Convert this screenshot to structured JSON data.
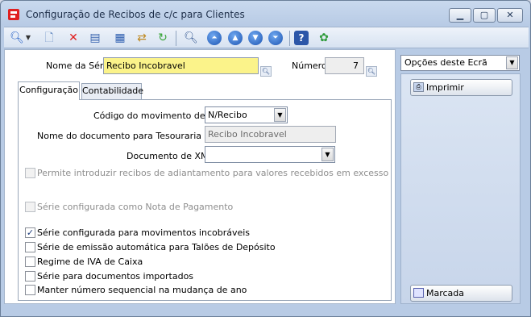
{
  "window": {
    "title": "Configuração de Recibos de c/c para Clientes",
    "controls": {
      "minimize": "▁",
      "maximize": "▢",
      "close": "✕"
    }
  },
  "toolbar": {
    "icons": [
      "search-icon",
      "dropdown-arrow-icon",
      "new-document-icon",
      "delete-icon",
      "properties-icon",
      "grid-icon",
      "import-icon",
      "refresh-icon",
      "preview-icon",
      "first-record-icon",
      "previous-record-icon",
      "next-record-icon",
      "last-record-icon",
      "help-icon",
      "options-icon"
    ]
  },
  "header": {
    "serie_label": "Nome da Série",
    "serie_value": "Recibo Incobravel",
    "numero_label": "Número",
    "numero_value": "7"
  },
  "tabs": [
    {
      "label": "Configuração",
      "active": true
    },
    {
      "label": "Contabilidade",
      "active": false
    }
  ],
  "config": {
    "codigo_label": "Código do movimento de c/c",
    "codigo_value": "N/Recibo",
    "nome_doc_label": "Nome do documento para Tesouraria Real",
    "nome_doc_value": "Recibo Incobravel",
    "xml_label": "Documento de XML",
    "xml_value": "",
    "checkboxes": [
      {
        "label": "Permite introduzir recibos de adiantamento para valores recebidos em excesso",
        "checked": false,
        "enabled": false
      },
      {
        "label": "Série configurada como Nota de Pagamento",
        "checked": false,
        "enabled": false
      },
      {
        "label": "Série configurada para movimentos incobráveis",
        "checked": true,
        "enabled": true
      },
      {
        "label": "Série de emissão automática para Talões de Depósito",
        "checked": false,
        "enabled": true
      },
      {
        "label": "Regime de IVA de Caixa",
        "checked": false,
        "enabled": true
      },
      {
        "label": "Série para documentos importados",
        "checked": false,
        "enabled": true
      },
      {
        "label": "Manter número sequencial na mudança de ano",
        "checked": false,
        "enabled": true
      }
    ]
  },
  "side": {
    "options_label": "Opções deste Ecrã",
    "imprimir_label": "Imprimir",
    "marcada_label": "Marcada"
  }
}
